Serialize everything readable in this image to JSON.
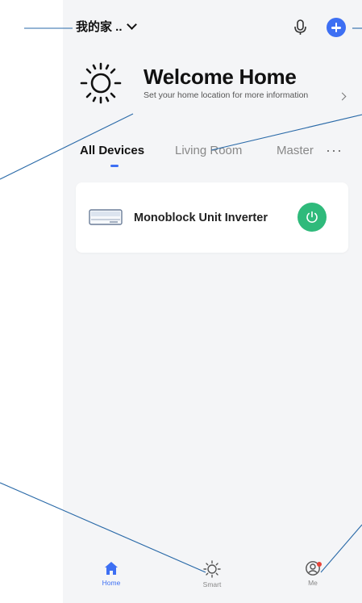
{
  "header": {
    "home_name": "我的家 ..",
    "icons": {
      "mic": "microphone-icon",
      "add": "add-circle-icon"
    }
  },
  "welcome": {
    "title": "Welcome Home",
    "subtitle": "Set your home location for more information",
    "icon": "sun-icon"
  },
  "tabs": [
    {
      "label": "All Devices",
      "active": true
    },
    {
      "label": "Living Room",
      "active": false
    },
    {
      "label": "Master",
      "active": false
    }
  ],
  "tabs_more": "···",
  "devices": [
    {
      "name": "Monoblock Unit Inverter",
      "icon": "air-conditioner-icon",
      "power_icon": "power-icon"
    }
  ],
  "tabbar": [
    {
      "label": "Home",
      "icon": "home-icon",
      "active": true
    },
    {
      "label": "Smart",
      "icon": "sun-icon",
      "active": false
    },
    {
      "label": "Me",
      "icon": "user-icon",
      "active": false,
      "badge": true
    }
  ],
  "colors": {
    "accent": "#3d6ff3",
    "power_on": "#2fba7b",
    "badge": "#e8443a",
    "background": "#f4f5f7",
    "callout_line": "#2a6aa8"
  }
}
